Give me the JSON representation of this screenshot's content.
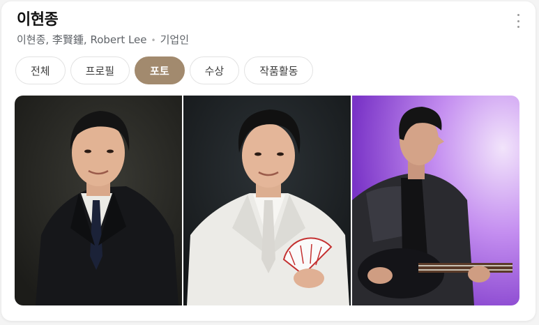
{
  "header": {
    "title": "이현종",
    "subtitle_names": "이현종, 李賢鍾, Robert Lee",
    "separator": "•",
    "subtitle_role": "기업인"
  },
  "tabs": [
    {
      "label": "전체",
      "active": false
    },
    {
      "label": "프로필",
      "active": false
    },
    {
      "label": "포토",
      "active": true
    },
    {
      "label": "수상",
      "active": false
    },
    {
      "label": "작품활동",
      "active": false
    }
  ],
  "icons": {
    "more": "more-vertical-icon"
  },
  "colors": {
    "active_tab": "#a28a6e",
    "photo1_bg": "#2b2b27",
    "photo2_bg": "#1f2326",
    "photo3_bg": "#b06fe8"
  }
}
